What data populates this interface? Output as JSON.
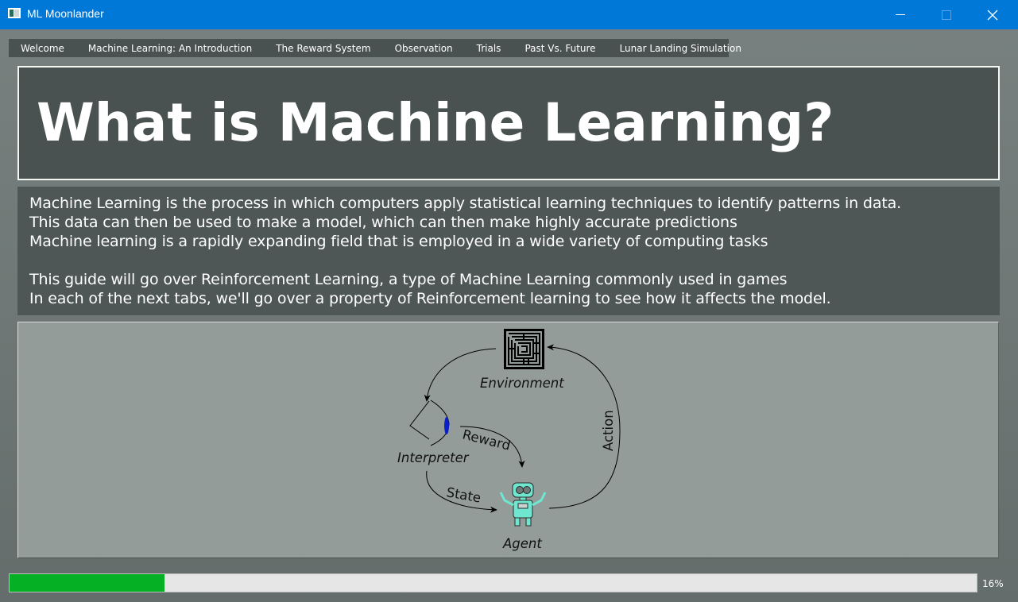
{
  "window": {
    "title": "ML Moonlander",
    "titlebar_color": "#0078d7",
    "icons": [
      "app-icon",
      "minimize-icon",
      "maximize-icon",
      "close-icon"
    ]
  },
  "tabs": [
    {
      "label": "Welcome",
      "active": false
    },
    {
      "label": "Machine Learning: An Introduction",
      "active": true
    },
    {
      "label": "The Reward System",
      "active": false
    },
    {
      "label": "Observation",
      "active": false
    },
    {
      "label": "Trials",
      "active": false
    },
    {
      "label": "Past Vs. Future",
      "active": false
    },
    {
      "label": "Lunar Landing Simulation",
      "active": false
    }
  ],
  "header": {
    "title": "What is Machine Learning?"
  },
  "body_text": {
    "lines": [
      "Machine Learning is the process in which computers apply statistical learning techniques to identify patterns in data.",
      "This data can then be used to make a model, which can then make highly accurate predictions",
      "Machine learning is a rapidly expanding field that is employed in a wide variety of computing tasks",
      "",
      "This guide will go over Reinforcement Learning, a type of Machine Learning commonly used in games",
      "In each of the next tabs, we'll go over a property of Reinforcement learning to see how it affects the model."
    ]
  },
  "diagram": {
    "labels": {
      "environment": "Environment",
      "interpreter": "Interpreter",
      "agent": "Agent",
      "reward": "Reward",
      "state": "State",
      "action": "Action"
    },
    "icons": [
      "maze-icon",
      "eye-icon",
      "robot-icon"
    ]
  },
  "progress": {
    "value": 0.16,
    "text": "16%",
    "fill_color": "#06b025"
  }
}
